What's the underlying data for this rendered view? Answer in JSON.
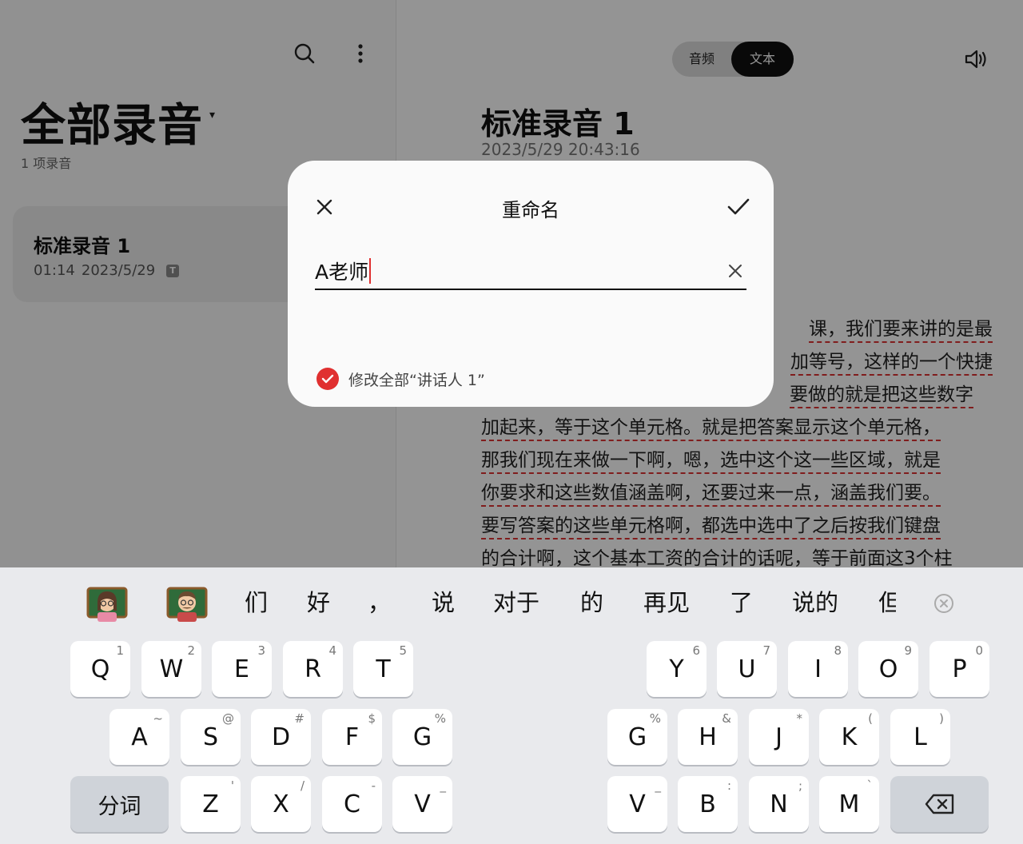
{
  "left_pane": {
    "title": "全部录音",
    "dropdown_glyph": "▾",
    "count": "1 项录音",
    "icons": {
      "search": "search-icon",
      "more": "more-vertical-icon"
    },
    "recording": {
      "name": "标准录音 1",
      "duration": "01:14",
      "date": "2023/5/29",
      "badge": "T"
    }
  },
  "right_pane": {
    "toggle": {
      "audio": "音频",
      "text": "文本",
      "selected": "文本"
    },
    "speaker_icon": "speaker-icon",
    "title": "标准录音 1",
    "datetime": "2023/5/29 20:43:16",
    "transcript_lines": [
      "课，我们要来讲的是最",
      "加等号，这样的一个快捷",
      "要做的就是把这些数字",
      "加起来，等于这个单元格。就是把答案显示这个单元格，",
      "那我们现在来做一下啊，嗯，选中这个这一些区域，就是",
      "你要求和这些数值涵盖啊，还要过来一点，涵盖我们要。",
      "要写答案的这些单元格啊，都选中选中了之后按我们键盘",
      "的合计啊，这个基本工资的合计的话呢，等于前面这3个柱"
    ]
  },
  "dialog": {
    "title": "重命名",
    "input_value": "A老师",
    "apply_all_label": "修改全部“讲话人 1”",
    "apply_all_checked": true,
    "accent_color": "#e03030"
  },
  "keyboard": {
    "emoji_candidates": [
      "woman-teacher-emoji",
      "man-teacher-emoji"
    ],
    "candidates": [
      "们",
      "好",
      "，",
      "说",
      "对于",
      "的",
      "再见",
      "了",
      "说的",
      "但"
    ],
    "row1_left": [
      {
        "main": "Q",
        "sub": "1"
      },
      {
        "main": "W",
        "sub": "2"
      },
      {
        "main": "E",
        "sub": "3"
      },
      {
        "main": "R",
        "sub": "4"
      },
      {
        "main": "T",
        "sub": "5"
      }
    ],
    "row1_right": [
      {
        "main": "Y",
        "sub": "6"
      },
      {
        "main": "U",
        "sub": "7"
      },
      {
        "main": "I",
        "sub": "8"
      },
      {
        "main": "O",
        "sub": "9"
      },
      {
        "main": "P",
        "sub": "0"
      }
    ],
    "row2_left": [
      {
        "main": "A",
        "sub": "~"
      },
      {
        "main": "S",
        "sub": "@"
      },
      {
        "main": "D",
        "sub": "#"
      },
      {
        "main": "F",
        "sub": "$"
      },
      {
        "main": "G",
        "sub": "%"
      }
    ],
    "row2_right": [
      {
        "main": "G",
        "sub": "%"
      },
      {
        "main": "H",
        "sub": "&"
      },
      {
        "main": "J",
        "sub": "*"
      },
      {
        "main": "K",
        "sub": "("
      },
      {
        "main": "L",
        "sub": ")"
      }
    ],
    "row3_left": [
      {
        "main": "Z",
        "sub": "'"
      },
      {
        "main": "X",
        "sub": "/"
      },
      {
        "main": "C",
        "sub": "-"
      },
      {
        "main": "V",
        "sub": "_"
      }
    ],
    "row3_right": [
      {
        "main": "V",
        "sub": "_"
      },
      {
        "main": "B",
        "sub": ":"
      },
      {
        "main": "N",
        "sub": ";"
      },
      {
        "main": "M",
        "sub": "`"
      }
    ],
    "fenci_label": "分词",
    "backspace_icon": "backspace-icon"
  }
}
